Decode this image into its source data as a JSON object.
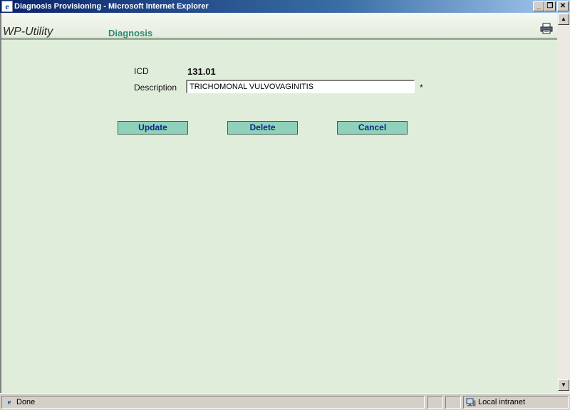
{
  "window": {
    "title": "Diagnosis Provisioning - Microsoft Internet Explorer",
    "minimize_glyph": "_",
    "maximize_glyph": "❐",
    "close_glyph": "✕"
  },
  "header": {
    "brand": "WP-Utility",
    "section_title": "Diagnosis"
  },
  "form": {
    "icd_label": "ICD",
    "icd_value": "131.01",
    "description_label": "Description",
    "description_value": "TRICHOMONAL VULVOVAGINITIS",
    "required_marker": "*"
  },
  "buttons": {
    "update": "Update",
    "delete": "Delete",
    "cancel": "Cancel"
  },
  "statusbar": {
    "status_text": "Done",
    "zone_text": "Local intranet"
  },
  "icons": [
    "ie-icon",
    "print-icon",
    "scroll-up-icon",
    "scroll-down-icon",
    "local-intranet-icon"
  ],
  "colors": {
    "content_bg": "#e1eddb",
    "section_title": "#2f8a73",
    "button_bg": "#8fd1bb",
    "button_text": "#0d2a8a"
  }
}
